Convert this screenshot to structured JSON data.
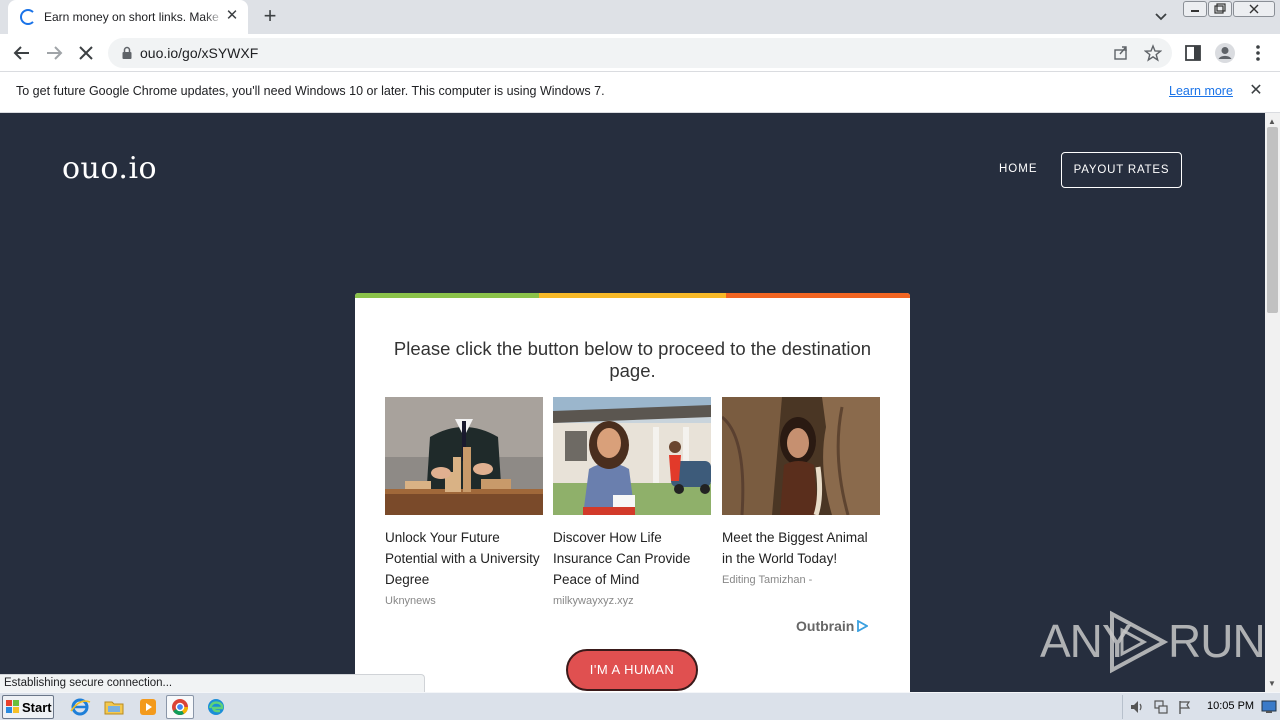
{
  "browser": {
    "tab_title": "Earn money on short links. Make short links and earn money",
    "tab_close": "✕",
    "new_tab": "+",
    "url": "ouo.io/go/xSYWXF"
  },
  "infobar": {
    "message": "To get future Google Chrome updates, you'll need Windows 10 or later. This computer is using Windows 7.",
    "learn_more": "Learn more",
    "close": "✕"
  },
  "site": {
    "logo": "ouo.io",
    "nav": {
      "home": "HOME",
      "payout": "PAYOUT RATES"
    },
    "card": {
      "heading": "Please click the button below to proceed to the destination page.",
      "recommendations": [
        {
          "title": "Unlock Your Future Potential with a University Degree",
          "source": "Uknynews"
        },
        {
          "title": "Discover How Life Insurance Can Provide Peace of Mind",
          "source": "milkywayxyz.xyz"
        },
        {
          "title": "Meet the Biggest Animal in the World Today!",
          "source": "Editing Tamizhan -"
        }
      ],
      "ad_network": "Outbrain",
      "human_button": "I'M A HUMAN"
    }
  },
  "status": {
    "text": "Establishing secure connection..."
  },
  "watermark": {
    "left": "ANY",
    "right": "RUN"
  },
  "taskbar": {
    "start": "Start",
    "clock": "10:05 PM"
  },
  "colors": {
    "page_bg": "#262e3e",
    "button_red": "#e05050",
    "bar_green": "#8bc34a",
    "bar_yellow": "#f7b928",
    "bar_orange": "#f26522",
    "link_blue": "#1a73e8"
  }
}
